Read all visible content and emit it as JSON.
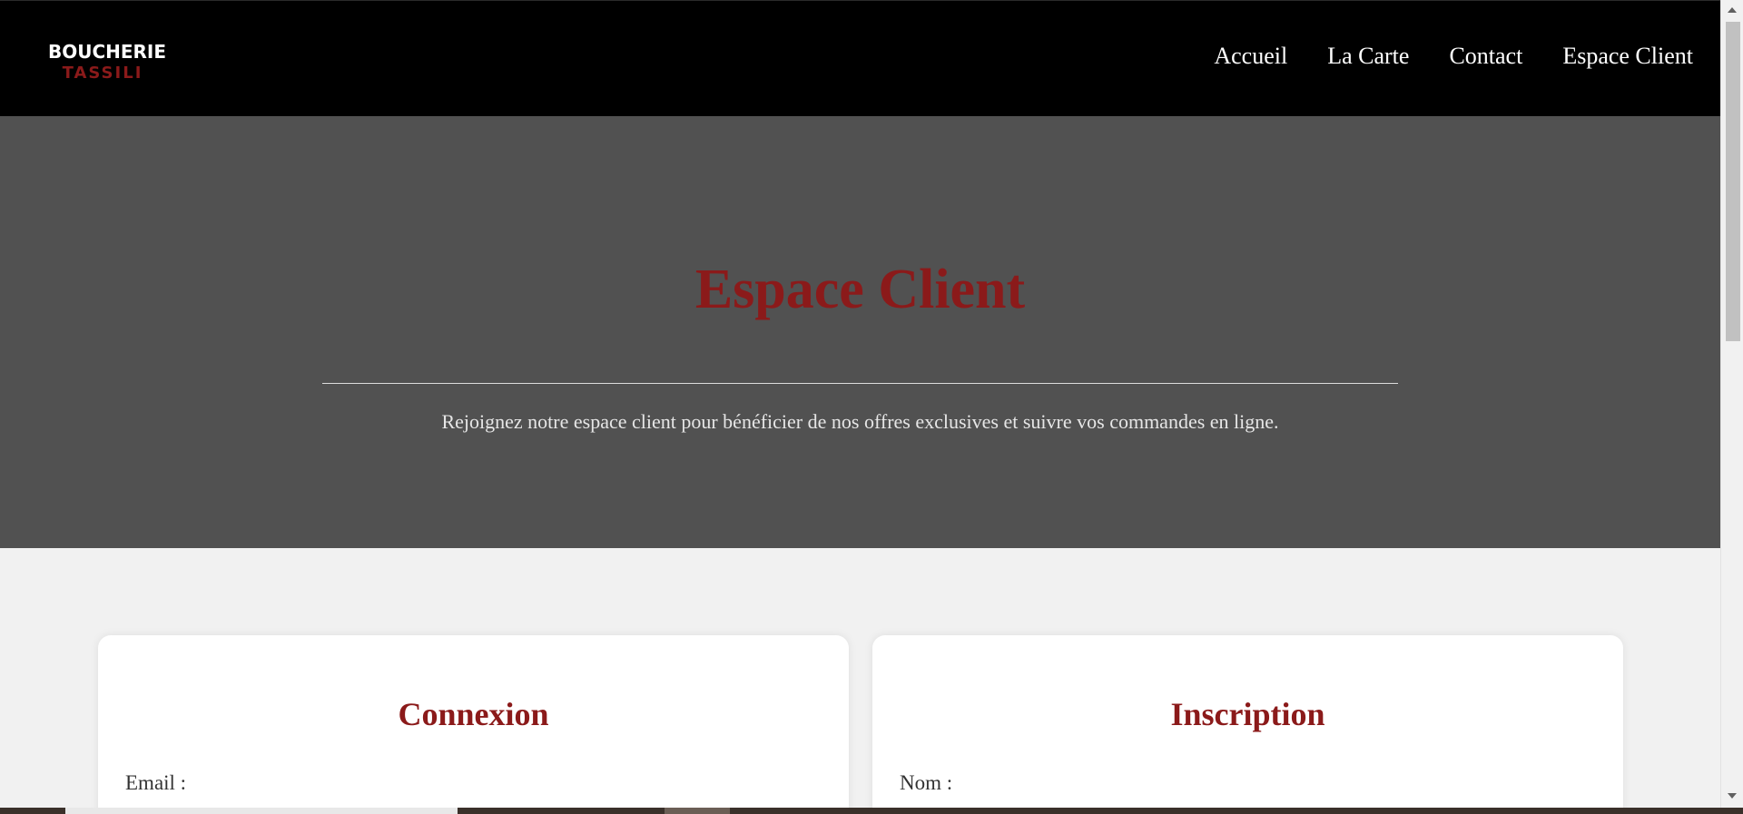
{
  "header": {
    "logo_top": "BOUCHERIE",
    "logo_bottom": "TASSILI",
    "nav": [
      {
        "label": "Accueil"
      },
      {
        "label": "La Carte"
      },
      {
        "label": "Contact"
      },
      {
        "label": "Espace Client"
      }
    ]
  },
  "hero": {
    "title": "Espace Client",
    "subtitle": "Rejoignez notre espace client pour bénéficier de nos offres exclusives et suivre vos commandes en ligne."
  },
  "login_card": {
    "title": "Connexion",
    "email_label": "Email :"
  },
  "signup_card": {
    "title": "Inscription",
    "name_label": "Nom :"
  },
  "colors": {
    "accent": "#8b1a1a",
    "header_bg": "#000000",
    "hero_bg": "#515151",
    "page_bg": "#f1f1f1"
  }
}
